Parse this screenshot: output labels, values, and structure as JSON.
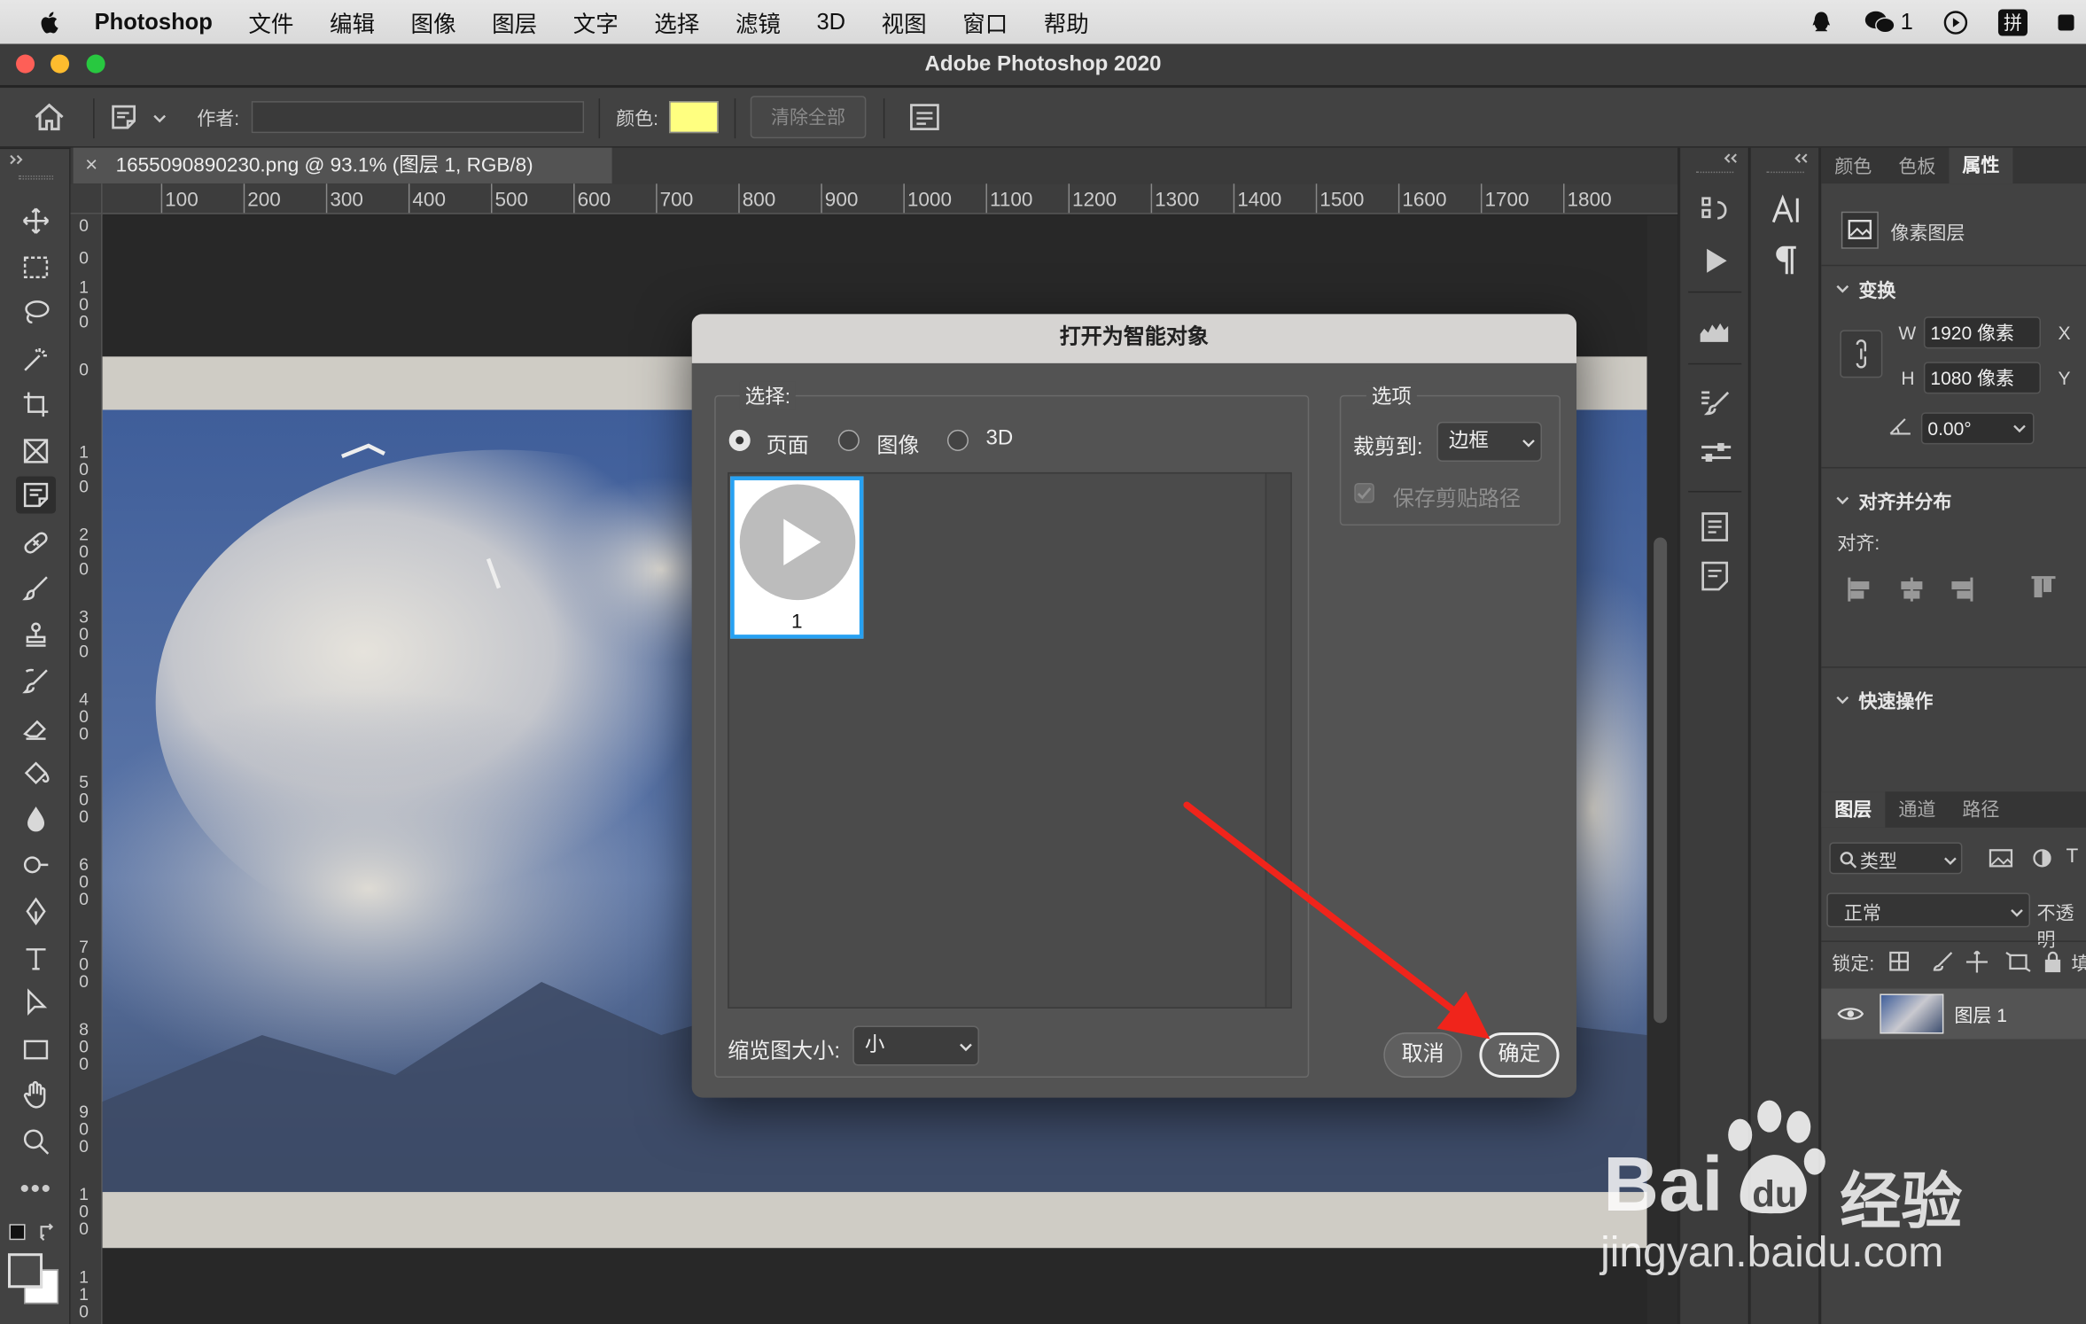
{
  "menubar": {
    "app": "Photoshop",
    "items": [
      "文件",
      "编辑",
      "图像",
      "图层",
      "文字",
      "选择",
      "滤镜",
      "3D",
      "视图",
      "窗口",
      "帮助"
    ],
    "wechat_count": "1",
    "ime": "拼"
  },
  "window": {
    "title": "Adobe Photoshop 2020"
  },
  "options": {
    "author_label": "作者:",
    "author_value": "",
    "color_label": "颜色:",
    "note_color": "#ffff80",
    "clear_all": "清除全部"
  },
  "document": {
    "tab": "1655090890230.png @ 93.1% (图层 1, RGB/8)"
  },
  "ruler": {
    "h": [
      "100",
      "200",
      "300",
      "400",
      "500",
      "600",
      "700",
      "800",
      "900",
      "1000",
      "1100",
      "1200",
      "1300",
      "1400",
      "1500",
      "1600",
      "1700",
      "1800"
    ],
    "v": [
      "0",
      "0",
      "1\n0\n0",
      "0",
      "1\n0\n0",
      "2\n0\n0",
      "3\n0\n0",
      "4\n0\n0",
      "5\n0\n0",
      "6\n0\n0",
      "7\n0\n0",
      "8\n0\n0",
      "9\n0\n0",
      "1\n0\n0",
      "1\n1\n0"
    ]
  },
  "dialog": {
    "title": "打开为智能对象",
    "select_label": "选择:",
    "radio_page": "页面",
    "radio_image": "图像",
    "radio_3d": "3D",
    "thumb_page": "1",
    "thumb_size_label": "缩览图大小:",
    "thumb_size_value": "小",
    "options_label": "选项",
    "crop_label": "裁剪到:",
    "crop_value": "边框",
    "preserve_clip": "保存剪贴路径",
    "cancel": "取消",
    "ok": "确定"
  },
  "properties": {
    "tabs": [
      "颜色",
      "色板",
      "属性"
    ],
    "layer_kind": "像素图层",
    "transform": "变换",
    "w_label": "W",
    "w_value": "1920 像素",
    "h_label": "H",
    "h_value": "1080 像素",
    "x_label": "X",
    "y_label": "Y",
    "angle": "0.00°",
    "align": "对齐并分布",
    "align_sub": "对齐:",
    "quick": "快速操作"
  },
  "layers": {
    "tabs": [
      "图层",
      "通道",
      "路径"
    ],
    "filter": "类型",
    "blend": "正常",
    "opacity_label": "不透明",
    "lock_label": "锁定:",
    "fill_label": "填",
    "layer_name": "图层 1"
  },
  "watermark": {
    "brand": "Bai",
    "du": "du",
    "cn": "经验",
    "url": "jingyan.baidu.com"
  }
}
